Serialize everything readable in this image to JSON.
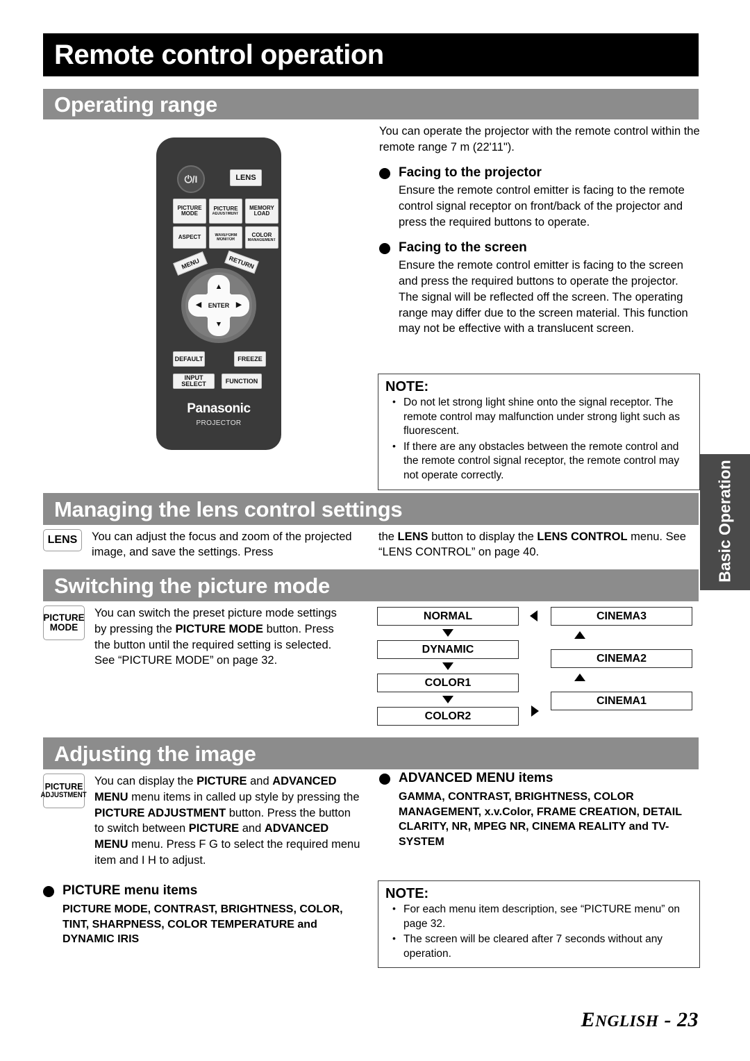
{
  "page": {
    "title": "Remote control operation",
    "side_tab": "Basic Operation",
    "footer": "ENGLISH - 23"
  },
  "sections": {
    "operating_range": {
      "heading": "Operating range",
      "intro": "You can operate the projector with the remote control within the remote range 7 m (22'11\").",
      "facing_projector": {
        "heading": "Facing to the projector",
        "body": "Ensure the remote control emitter is facing to the remote control signal receptor on front/back of the projector and press the required buttons to operate."
      },
      "facing_screen": {
        "heading": "Facing to the screen",
        "body": "Ensure the remote control emitter is facing to the screen and press the required buttons to operate the projector. The signal will be reflected off the screen. The operating range may differ due to the screen material. This function may not be effective with a translucent screen."
      },
      "note": {
        "title": "NOTE:",
        "items": [
          "Do not let strong light shine onto the signal receptor. The remote control may malfunction under strong light such as fluorescent.",
          "If there are any obstacles between the remote control and the remote control signal receptor, the remote control may not operate correctly."
        ]
      }
    },
    "lens_control": {
      "heading": "Managing the lens control settings",
      "key_label": "LENS",
      "text_left": "You can adjust the focus and zoom of the projected image, and save the settings. Press",
      "text_right_html": "the <b>LENS</b> button to display the <b>LENS CONTROL</b> menu. See “LENS CONTROL” on page 40."
    },
    "picture_mode": {
      "heading": "Switching the picture mode",
      "key_line1": "PICTURE",
      "key_line2": "MODE",
      "text_html": "You can switch the preset picture mode settings by pressing the <b>PICTURE MODE</b> button. Press the button until the required setting is selected. See “PICTURE MODE” on page 32.",
      "flow_left": [
        "NORMAL",
        "DYNAMIC",
        "COLOR1",
        "COLOR2"
      ],
      "flow_right": [
        "CINEMA3",
        "CINEMA2",
        "CINEMA1"
      ]
    },
    "adjusting_image": {
      "heading": "Adjusting the image",
      "key_line1": "PICTURE",
      "key_line2": "ADJUSTMENT",
      "text_html": "You can display the <b>PICTURE</b> and <b>ADVANCED MENU</b> menu items in called up style by pressing the <b>PICTURE ADJUSTMENT</b> button. Press the button to switch between <b>PICTURE</b> and <b>ADVANCED MENU</b> menu. Press F  G  to select the required menu item and I   H  to adjust.",
      "picture_menu": {
        "heading_html": "<b>PICTURE</b> menu items",
        "items_html": "<b>PICTURE MODE</b>, <b>CONTRAST</b>, <b>BRIGHTNESS</b>, <b>COLOR</b>, <b>TINT</b>, <b>SHARPNESS</b>, <b>COLOR TEMPERATURE</b> and <b>DYNAMIC IRIS</b>"
      },
      "advanced_menu": {
        "heading_html": "<b>ADVANCED MENU</b> items",
        "items_html": "<b>GAMMA</b>, <b>CONTRAST</b>, <b>BRIGHTNESS</b>, <b>COLOR MANAGEMENT</b>, <b>x.v.Color</b>, <b>FRAME CREATION</b>, <b>DETAIL CLARITY</b>, <b>NR</b>, <b>MPEG NR</b>, <b>CINEMA REALITY</b> and <b>TV-SYSTEM</b>"
      },
      "note": {
        "title": "NOTE:",
        "items": [
          "For each menu item description, see “PICTURE menu” on page 32.",
          "The screen will be cleared after 7 seconds without any operation."
        ]
      }
    }
  },
  "remote": {
    "power": "⏻/I",
    "lens": "LENS",
    "buttons_row1": [
      {
        "l1": "PICTURE",
        "l2": "MODE"
      },
      {
        "l1": "PICTURE",
        "l2": "ADJUSTMENT"
      },
      {
        "l1": "MEMORY",
        "l2": "LOAD"
      }
    ],
    "buttons_row2": [
      {
        "l1": "ASPECT",
        "l2": ""
      },
      {
        "l1": "WAVEFORM",
        "l2": "MONITOR"
      },
      {
        "l1": "COLOR",
        "l2": "MANAGEMENT"
      }
    ],
    "menu": "MENU",
    "return": "RETURN",
    "enter": "ENTER",
    "arrow_up": "▲",
    "arrow_down": "▼",
    "arrow_left": "◀",
    "arrow_right": "▶",
    "default": "DEFAULT",
    "freeze": "FREEZE",
    "input_select": "INPUT SELECT",
    "function": "FUNCTION",
    "brand": "Panasonic",
    "brand_sub": "PROJECTOR"
  },
  "colors": {
    "title_bar": "#000000",
    "section_header": "#8c8c8c",
    "side_tab": "#4a4a4a",
    "remote_body": "#3a3a3a"
  }
}
